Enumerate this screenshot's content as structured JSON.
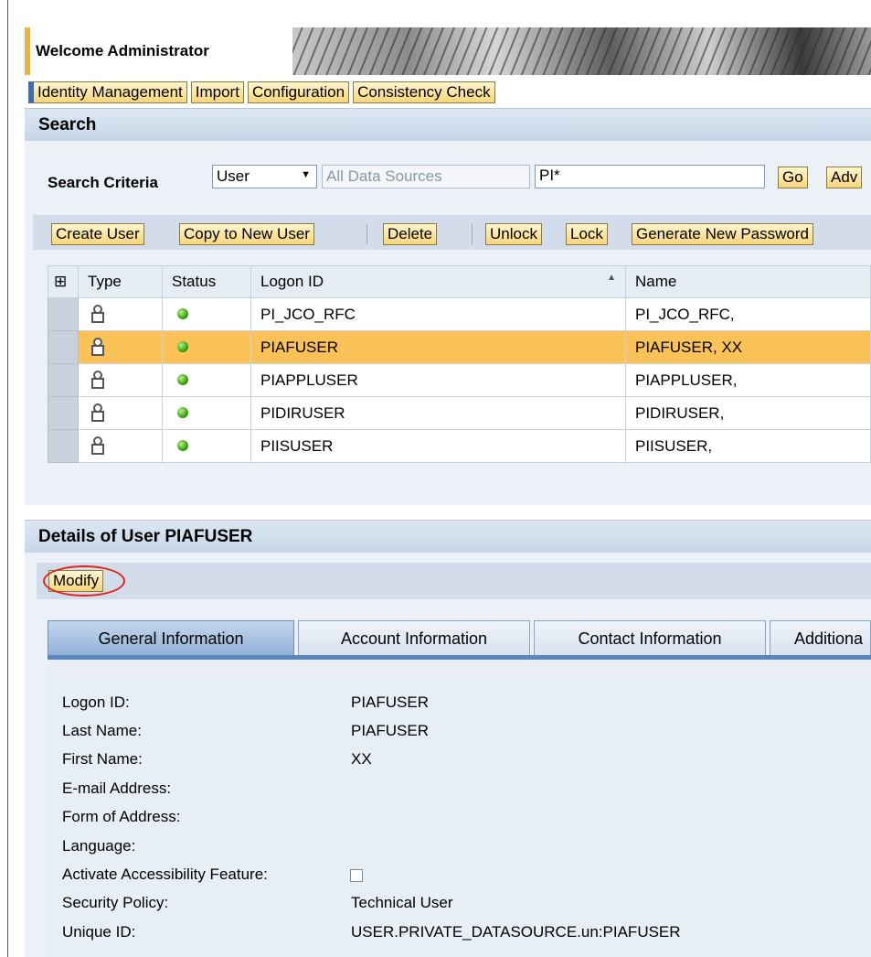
{
  "header": {
    "welcome": "Welcome Administrator"
  },
  "topnav": [
    "Identity Management",
    "Import",
    "Configuration",
    "Consistency Check"
  ],
  "search": {
    "title": "Search",
    "criteria_label": "Search Criteria",
    "type_value": "User",
    "datasource_placeholder": "All Data Sources",
    "query": "PI*",
    "go_label": "Go",
    "advanced_label": "Adv"
  },
  "toolbar": {
    "create": "Create User",
    "copy": "Copy to New User",
    "delete": "Delete",
    "unlock": "Unlock",
    "lock": "Lock",
    "genpw": "Generate New Password"
  },
  "table": {
    "headers": {
      "type": "Type",
      "status": "Status",
      "logon": "Logon ID",
      "name": "Name"
    },
    "rows": [
      {
        "logon": "PI_JCO_RFC",
        "name": "PI_JCO_RFC,",
        "selected": false
      },
      {
        "logon": "PIAFUSER",
        "name": "PIAFUSER, XX",
        "selected": true
      },
      {
        "logon": "PIAPPLUSER",
        "name": "PIAPPLUSER,",
        "selected": false
      },
      {
        "logon": "PIDIRUSER",
        "name": "PIDIRUSER,",
        "selected": false
      },
      {
        "logon": "PIISUSER",
        "name": "PIISUSER,",
        "selected": false
      }
    ]
  },
  "details": {
    "title": "Details of User PIAFUSER",
    "modify": "Modify",
    "tabs": [
      "General Information",
      "Account Information",
      "Contact Information",
      "Additiona"
    ],
    "fields": [
      {
        "label": "Logon ID:",
        "value": "PIAFUSER"
      },
      {
        "label": "Last Name:",
        "value": "PIAFUSER"
      },
      {
        "label": "First Name:",
        "value": "XX"
      },
      {
        "label": "E-mail Address:",
        "value": ""
      },
      {
        "label": "Form of Address:",
        "value": ""
      },
      {
        "label": "Language:",
        "value": ""
      },
      {
        "label": "Activate Accessibility Feature:",
        "value": ""
      },
      {
        "label": "Security Policy:",
        "value": "Technical User"
      },
      {
        "label": "Unique ID:",
        "value": "USER.PRIVATE_DATASOURCE.un:PIAFUSER"
      }
    ]
  }
}
